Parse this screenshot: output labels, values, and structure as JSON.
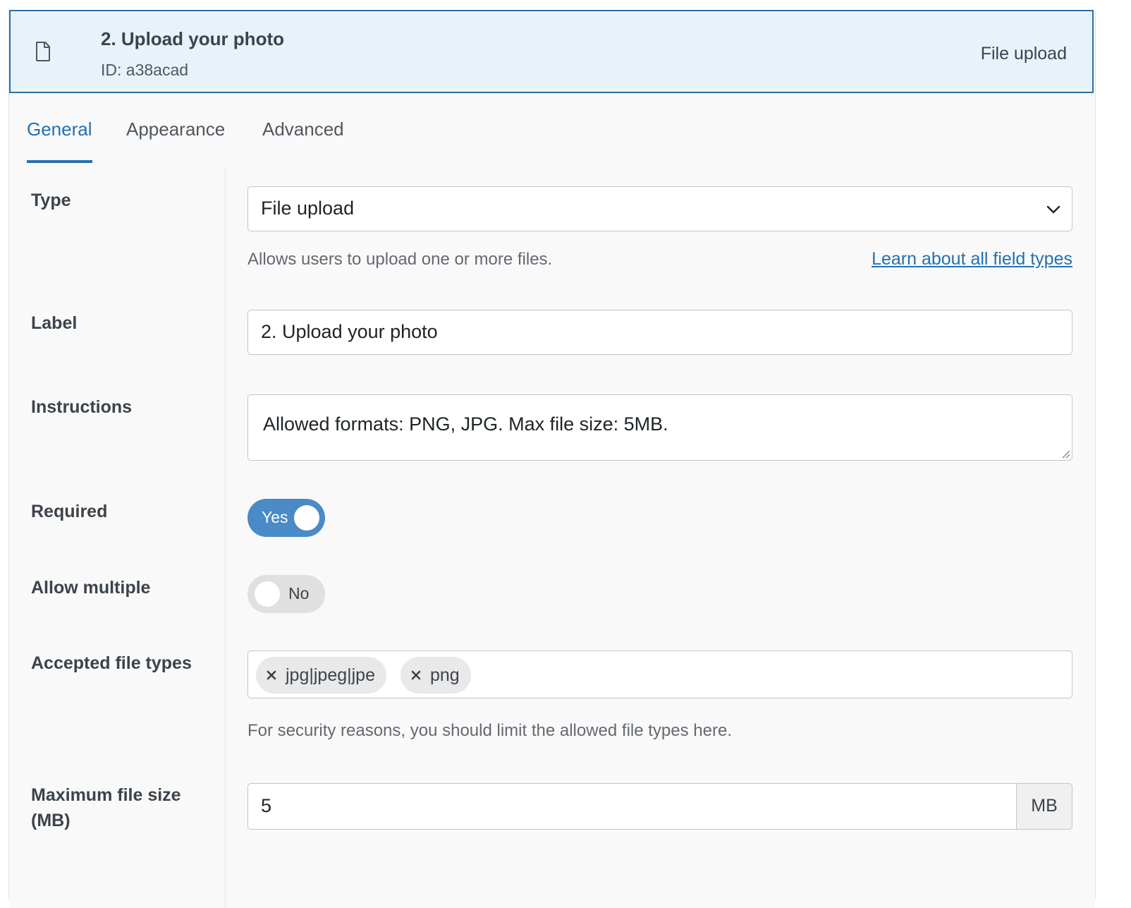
{
  "header": {
    "title": "2. Upload your photo",
    "id_text": "ID: a38acad",
    "type_text": "File upload",
    "icon": "file-icon"
  },
  "tabs": [
    {
      "label": "General",
      "active": true
    },
    {
      "label": "Appearance",
      "active": false
    },
    {
      "label": "Advanced",
      "active": false
    }
  ],
  "fields": {
    "type": {
      "label": "Type",
      "value": "File upload",
      "help": "Allows users to upload one or more files.",
      "link": "Learn about all field types"
    },
    "label": {
      "label": "Label",
      "value": "2. Upload your photo"
    },
    "instructions": {
      "label": "Instructions",
      "value": "Allowed formats: PNG, JPG. Max file size: 5MB."
    },
    "required": {
      "label": "Required",
      "state_label": "Yes",
      "on": true
    },
    "allow_multiple": {
      "label": "Allow multiple",
      "state_label": "No",
      "on": false
    },
    "accepted_types": {
      "label": "Accepted file types",
      "tags": [
        "jpg|jpeg|jpe",
        "png"
      ],
      "help": "For security reasons, you should limit the allowed file types here."
    },
    "max_size": {
      "label_line1": "Maximum file size",
      "label_line2": "(MB)",
      "value": "5",
      "suffix": "MB"
    }
  },
  "colors": {
    "accent": "#2271b1",
    "header_bg": "#e8f2f9",
    "header_border": "#2d6fa3",
    "toggle_on": "#4a8ac6",
    "toggle_off": "#e0e0e0"
  }
}
